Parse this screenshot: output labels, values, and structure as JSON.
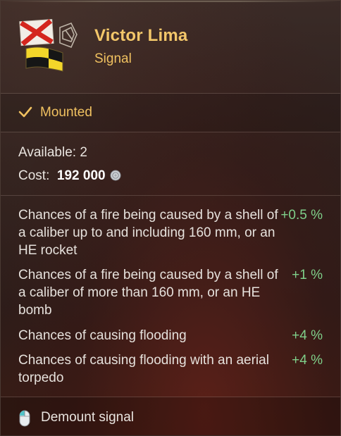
{
  "header": {
    "title": "Victor Lima",
    "subtitle": "Signal",
    "icon": "victor-lima-signal-flag-icon"
  },
  "status": {
    "icon": "checkmark-icon",
    "label": "Mounted"
  },
  "info": {
    "available_label": "Available:",
    "available_value": "2",
    "cost_label": "Cost:",
    "cost_value": "192 000",
    "cost_icon": "credits-coin-icon"
  },
  "bonuses": [
    {
      "text": "Chances of a fire being caused by a shell of a caliber up to and including 160 mm, or an HE rocket",
      "value": "+0.5 %"
    },
    {
      "text": "Chances of a fire being caused by a shell of a caliber of more than 160 mm, or an HE bomb",
      "value": "+1 %"
    },
    {
      "text": "Chances of causing flooding",
      "value": "+4 %"
    },
    {
      "text": "Chances of causing flooding with an aerial torpedo",
      "value": "+4 %"
    }
  ],
  "footer": {
    "icon": "mouse-left-click-icon",
    "label": "Demount signal"
  },
  "colors": {
    "title": "#f3c76a",
    "status": "#f0c160",
    "bonus_value": "#7fd08a",
    "background": "#2e201d"
  }
}
